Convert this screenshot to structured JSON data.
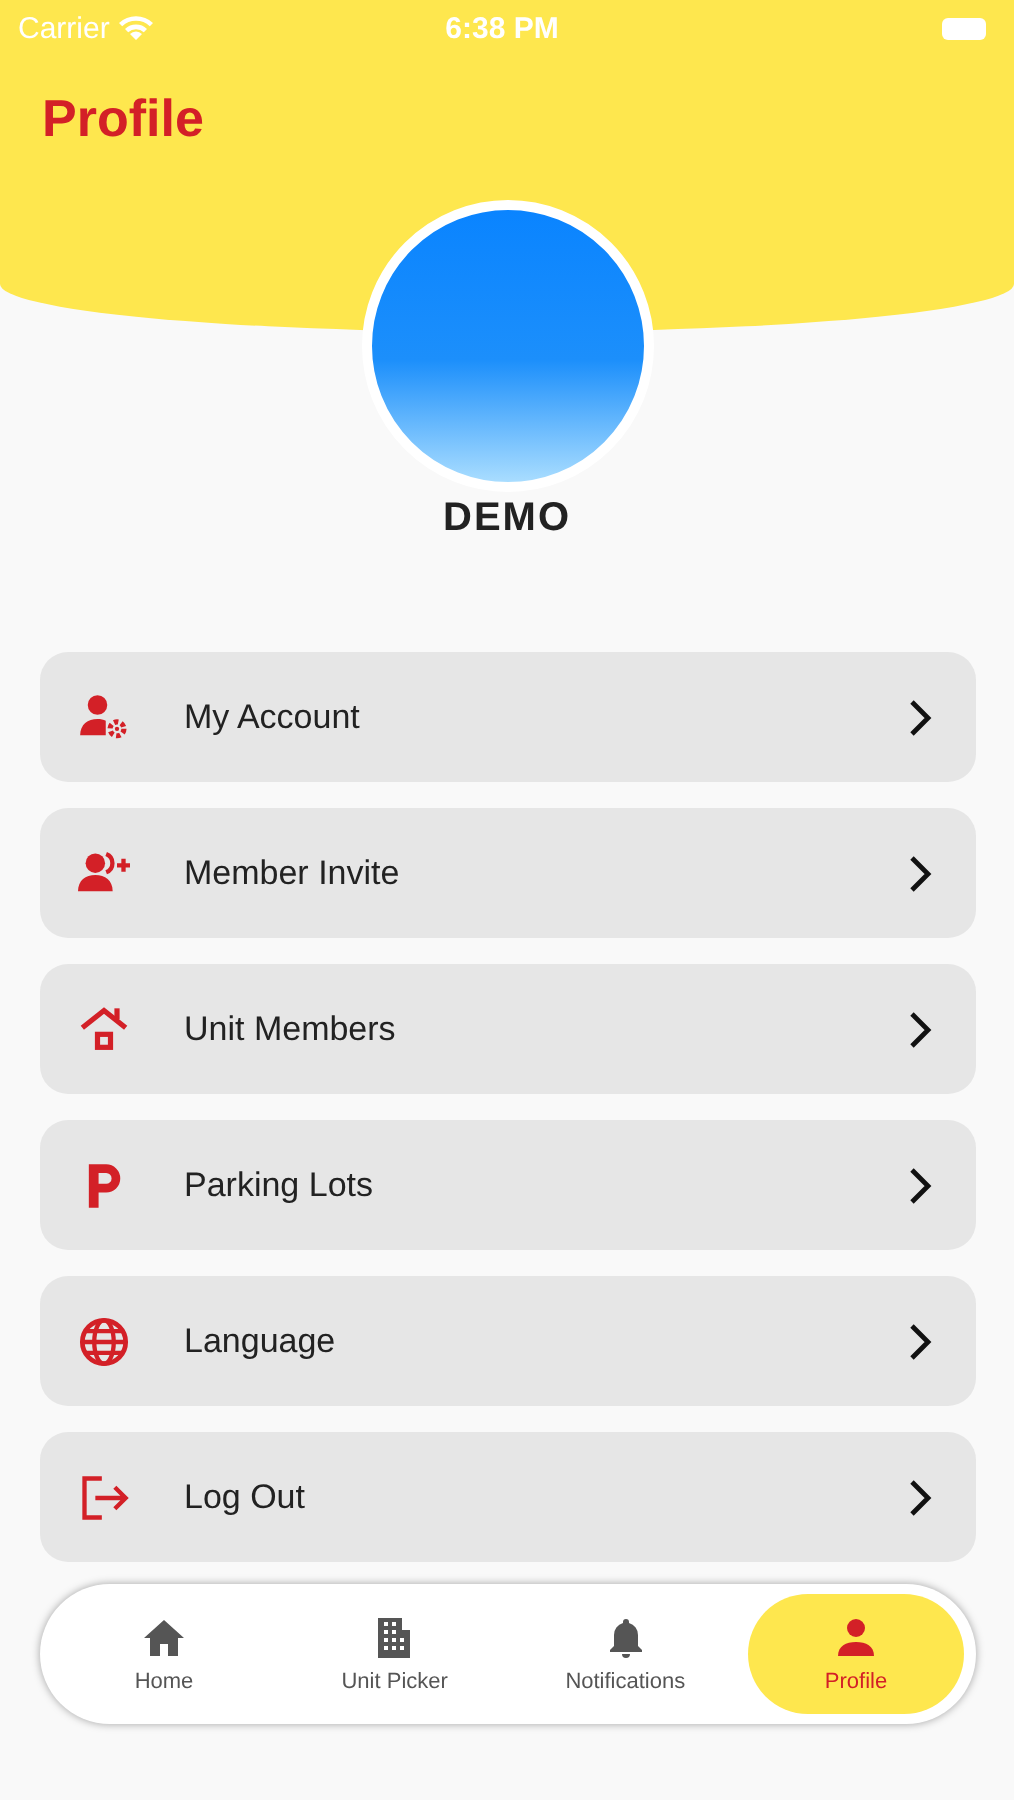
{
  "status_bar": {
    "carrier": "Carrier",
    "time": "6:38 PM"
  },
  "header": {
    "title": "Profile"
  },
  "profile": {
    "name": "DEMO"
  },
  "menu": [
    {
      "label": "My Account"
    },
    {
      "label": "Member Invite"
    },
    {
      "label": "Unit Members"
    },
    {
      "label": "Parking Lots"
    },
    {
      "label": "Language"
    },
    {
      "label": "Log Out"
    }
  ],
  "tab_bar": [
    {
      "label": "Home",
      "selected": false
    },
    {
      "label": "Unit Picker",
      "selected": false
    },
    {
      "label": "Notifications",
      "selected": false
    },
    {
      "label": "Profile",
      "selected": true
    }
  ]
}
